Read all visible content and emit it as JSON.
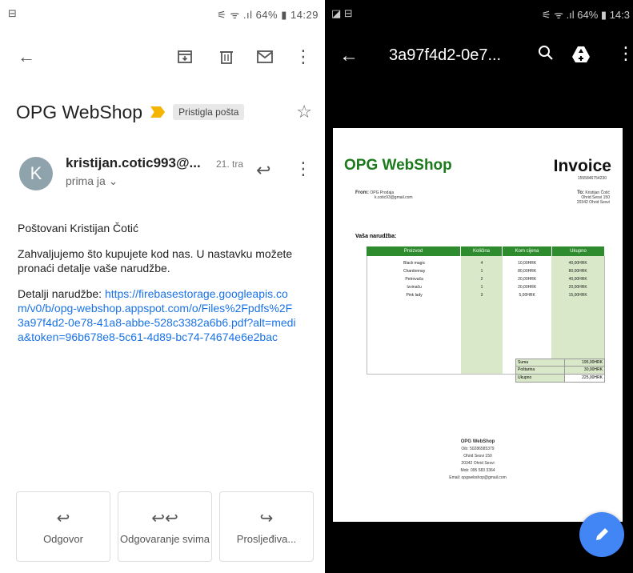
{
  "gmail": {
    "status": {
      "left": "⊟",
      "right": "⚟ ᯤ .ıl 64% ▮ 14:29"
    },
    "subject": "OPG WebShop",
    "label": "Pristigla pošta",
    "sender": "kristijan.cotic993@...",
    "date": "21. tra",
    "to": "prima ja ⌄",
    "avatar_letter": "K",
    "greeting": "Poštovani Kristijan Čotić",
    "paragraph": "Zahvaljujemo što kupujete kod nas. U nastavku možete pronaći detalje vaše narudžbe.",
    "details_label": "Detalji narudžbe:",
    "details_link": "https://firebasestorage.googleapis.com/v0/b/opg-webshop.appspot.com/o/Files%2Fpdfs%2F3a97f4d2-0e78-41a8-abbe-528c3382a6b6.pdf?alt=media&token=96b678e8-5c61-4d89-bc74-74674e6e2bac",
    "actions": [
      {
        "icon": "↩",
        "label": "Odgovor"
      },
      {
        "icon": "↩↩",
        "label": "Odgovaranje svima"
      },
      {
        "icon": "↪",
        "label": "Prosljeđiva..."
      }
    ]
  },
  "viewer": {
    "status": {
      "left": "◪ ⊟",
      "right": "⚟ ᯤ .ıl 64% ▮ 14:3"
    },
    "filename": "3a97f4d2-0e7...",
    "doc": {
      "brand": "OPG WebShop",
      "title": "Invoice",
      "invoice_no": "1555846754230",
      "from_label": "From:",
      "from_lines": [
        "OPG Prodaja",
        "k.cotic93@gmail.com"
      ],
      "to_label": "To:",
      "to_lines": [
        "Kristijan Čotić",
        "Ohrid Sesvi 150",
        "20342 Ohrid Sesvi"
      ],
      "order_label": "Vaša narudžba:",
      "headers": [
        "Proizvod",
        "Količina",
        "Kom cijena",
        "Ukupno"
      ],
      "rows": [
        [
          "Black magic",
          "4",
          "10,00HRK",
          "40,00HRK"
        ],
        [
          "Chardonnay",
          "1",
          "80,00HRK",
          "80,00HRK"
        ],
        [
          "Petrovača",
          "2",
          "20,00HRK",
          "40,00HRK"
        ],
        [
          "Izvinaču",
          "1",
          "20,00HRK",
          "20,00HRK"
        ],
        [
          "Pink lady",
          "3",
          "5,00HRK",
          "15,00HRK"
        ]
      ],
      "totals": [
        [
          "Suma",
          "195,00HRK"
        ],
        [
          "Poštarina",
          "30,00HRK"
        ],
        [
          "Ukupno",
          "225,00HRK"
        ]
      ],
      "footer_title": "OPG WebShop",
      "footer_lines": [
        "Oib: 50286585379",
        "Ohrid Sesvi 150",
        "20342 Ohrid Sesvi",
        "Mob: 095 583 3364",
        "Email: opgwebshop@gmail.com"
      ]
    }
  }
}
